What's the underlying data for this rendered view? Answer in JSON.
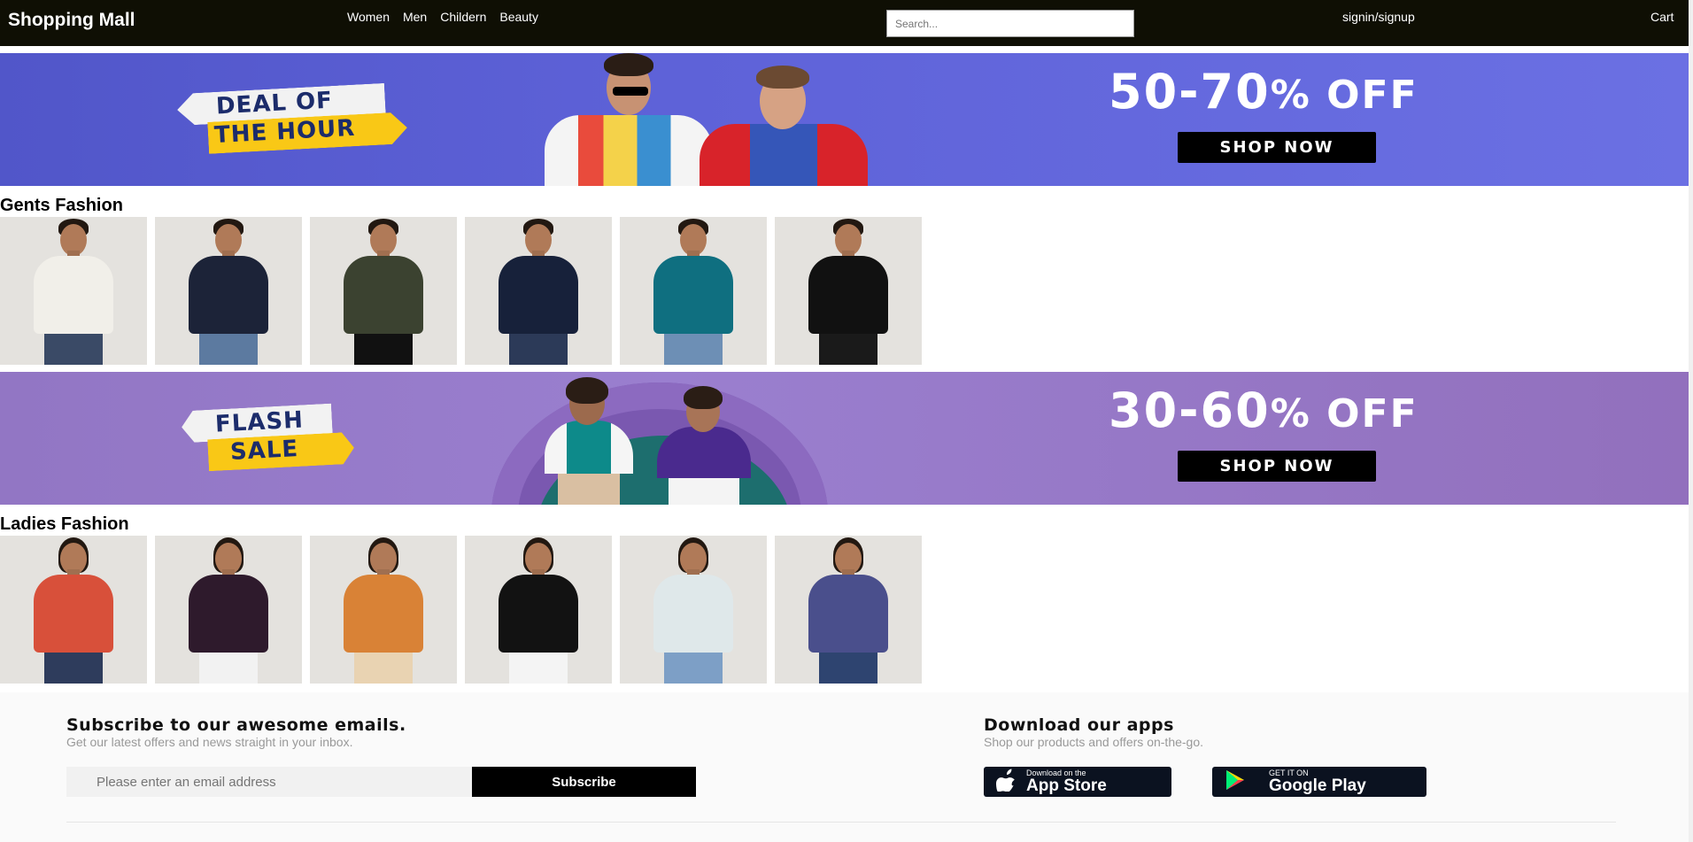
{
  "header": {
    "brand": "Shopping Mall",
    "nav": [
      "Women",
      "Men",
      "Childern",
      "Beauty"
    ],
    "search_placeholder": "Search...",
    "signin": "signin/signup",
    "cart": "Cart"
  },
  "banners": [
    {
      "tag_line1": "DEAL OF",
      "tag_line2": "THE HOUR",
      "offer_range": "50-70",
      "offer_pct": "%",
      "offer_off": " OFF",
      "cta": "SHOP NOW"
    },
    {
      "tag_line1": "FLASH",
      "tag_line2": "SALE",
      "offer_range": "30-60",
      "offer_pct": "%",
      "offer_off": " OFF",
      "cta": "SHOP NOW"
    }
  ],
  "sections": [
    {
      "title": "Gents Fashion",
      "products": [
        {
          "shirt": "#f1efe9",
          "pants": "#3a4a66"
        },
        {
          "shirt": "#1c2338",
          "pants": "#5c7aa0"
        },
        {
          "shirt": "#3b4230",
          "pants": "#111111"
        },
        {
          "shirt": "#17213a",
          "pants": "#2c3a58"
        },
        {
          "shirt": "#0f6f80",
          "pants": "#6d8fb5"
        },
        {
          "shirt": "#111111",
          "pants": "#1a1a1a"
        }
      ]
    },
    {
      "title": "Ladies Fashion",
      "products": [
        {
          "shirt": "#d8503a",
          "pants": "#2e3c5c"
        },
        {
          "shirt": "#2e1a2c",
          "pants": "#f2f2f2"
        },
        {
          "shirt": "#d98236",
          "pants": "#e9d3b2"
        },
        {
          "shirt": "#121212",
          "pants": "#f4f4f4"
        },
        {
          "shirt": "#dfe8ea",
          "pants": "#7d9fc6"
        },
        {
          "shirt": "#4a4f8c",
          "pants": "#2e4470"
        }
      ]
    }
  ],
  "footer": {
    "subscribe_title": "Subscribe to our awesome emails.",
    "subscribe_sub": "Get our latest offers and news straight in your inbox.",
    "email_placeholder": "Please enter an email address",
    "subscribe_button": "Subscribe",
    "apps_title": "Download our apps",
    "apps_sub": "Shop our products and offers on-the-go.",
    "appstore_small": "Download on the",
    "appstore_big": "App Store",
    "googleplay_small": "GET IT ON",
    "googleplay_big": "Google Play"
  }
}
